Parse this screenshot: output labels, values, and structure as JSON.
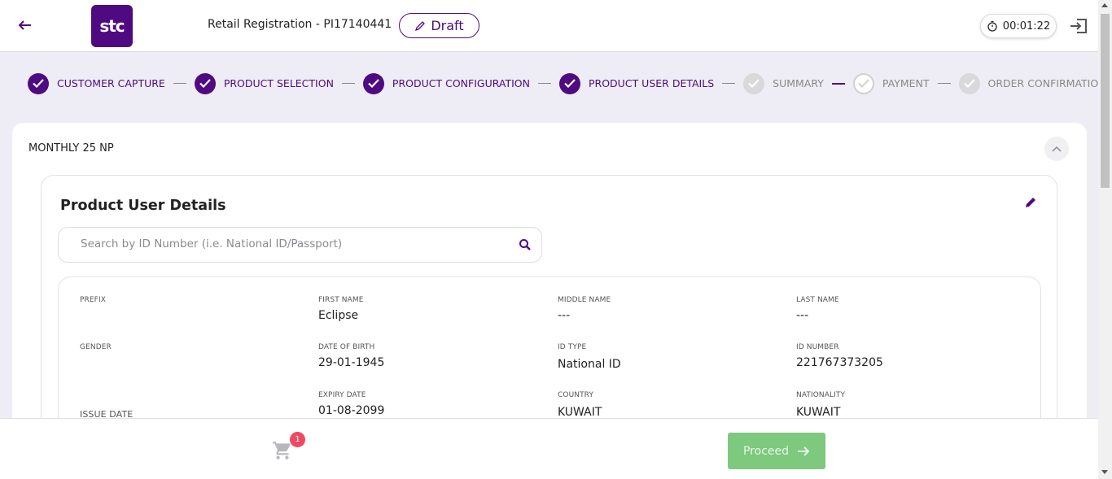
{
  "header": {
    "title": "Retail Registration - PI17140441",
    "logo_text": "stc",
    "draft_label": "Draft",
    "timer": "00:01:22"
  },
  "stepper": {
    "steps": [
      {
        "label": "CUSTOMER CAPTURE",
        "status": "done"
      },
      {
        "label": "PRODUCT SELECTION",
        "status": "done"
      },
      {
        "label": "PRODUCT CONFIGURATION",
        "status": "done"
      },
      {
        "label": "PRODUCT USER DETAILS",
        "status": "done"
      },
      {
        "label": "SUMMARY",
        "status": "pending"
      },
      {
        "label": "PAYMENT",
        "status": "pending"
      },
      {
        "label": "ORDER CONFIRMATION",
        "status": "pending"
      }
    ]
  },
  "main": {
    "plan_name": "MONTHLY 25 NP",
    "details_title": "Product User Details",
    "search_placeholder": "Search by ID Number (i.e. National ID/Passport)",
    "fields": {
      "prefix": {
        "label": "PREFIX",
        "value": ""
      },
      "first_name": {
        "label": "FIRST NAME",
        "value": "Eclipse"
      },
      "middle_name": {
        "label": "MIDDLE NAME",
        "value": "---"
      },
      "last_name": {
        "label": "LAST NAME",
        "value": "---"
      },
      "gender": {
        "label": "GENDER",
        "value": ""
      },
      "dob": {
        "label": "DATE OF BIRTH",
        "value": "29-01-1945"
      },
      "id_type": {
        "label": "ID TYPE",
        "value": "National ID"
      },
      "id_number": {
        "label": "ID NUMBER",
        "value": "221767373205"
      },
      "issue_date": {
        "label": "ISSUE DATE",
        "value": ""
      },
      "expiry_date": {
        "label": "EXPIRY DATE",
        "value": "01-08-2099"
      },
      "country": {
        "label": "COUNTRY",
        "value": "KUWAIT"
      },
      "nationality": {
        "label": "NATIONALITY",
        "value": "KUWAIT"
      }
    }
  },
  "footer": {
    "cart_count": "1",
    "proceed_label": "Proceed"
  },
  "colors": {
    "brand": "#4f0a81",
    "proceed": "#7dc97d",
    "badge": "#f04860"
  }
}
